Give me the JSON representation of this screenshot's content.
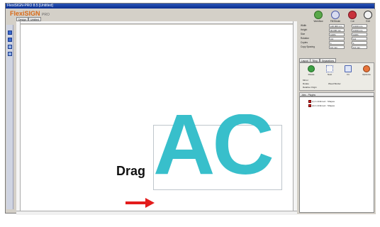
{
  "window": {
    "title": "FlexiSIGN-PRO 8.5 [Untitled]"
  },
  "app": {
    "logo_main": "FlexiSIGN",
    "logo_suffix": "PRO"
  },
  "document_tabs": [
    "Design",
    "Untitled"
  ],
  "toolbar_right": [
    {
      "label": "Workflow",
      "icon": "workflow-icon"
    },
    {
      "label": "Fill/Stroke",
      "icon": "fill-stroke-icon"
    },
    {
      "label": "Cut",
      "icon": "cut-icon"
    },
    {
      "label": "Exit",
      "icon": "exit-icon"
    }
  ],
  "properties": [
    {
      "name": "Width",
      "value": "120.000 mm",
      "value2": "0.000 mm"
    },
    {
      "name": "Height",
      "value": "60.000 mm",
      "value2": "0.000 mm"
    },
    {
      "name": "Size",
      "value": "100%",
      "value2": "100%"
    },
    {
      "name": "Rotation",
      "value": "0.0",
      "value2": "0.0"
    },
    {
      "name": "Copies",
      "value": "1",
      "value2": "1"
    },
    {
      "name": "Copy Spacing",
      "value": "6.0 mm",
      "value2": "6.0 mm"
    }
  ],
  "panel_tabs": [
    "Layout",
    "Tiling",
    "Separations"
  ],
  "panel_buttons": [
    {
      "label": "Rotate",
      "icon": "rotate-icon"
    },
    {
      "label": "Nest",
      "icon": "nest-icon"
    },
    {
      "label": "Fit",
      "icon": "fit-icon"
    },
    {
      "label": "Optimize",
      "icon": "optimize-icon"
    }
  ],
  "panel_options": [
    "Mirror",
    "Rotate",
    "Relative Origin",
    "Weed Border"
  ],
  "layers": {
    "header": "Jobs  -  Plugins",
    "items": [
      "(1) C.ACE text : Shapes",
      "(2) C.ACE text : Shapes"
    ]
  },
  "annotation": {
    "drag_label": "Drag"
  },
  "colors": {
    "letters": "#38bfcb",
    "arrow": "#e31c1c"
  }
}
